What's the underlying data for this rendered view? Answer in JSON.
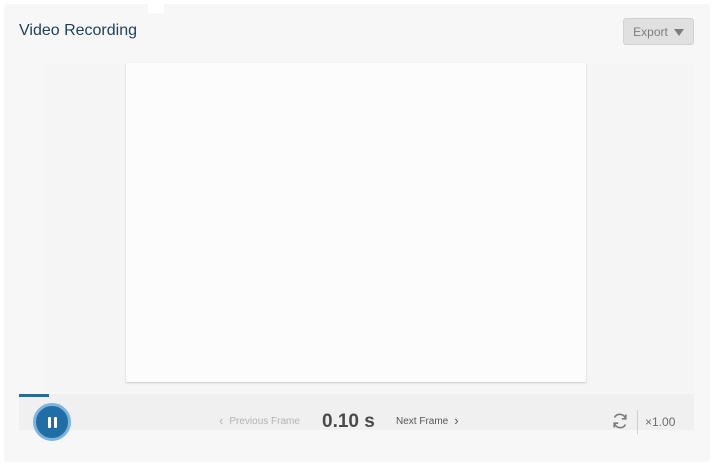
{
  "header": {
    "title": "Video Recording",
    "export_label": "Export"
  },
  "player": {
    "progress_fraction": 0.045,
    "state": "playing"
  },
  "controls": {
    "prev_label": "Previous Frame",
    "prev_enabled": false,
    "time": "0.10 s",
    "next_label": "Next Frame",
    "speed": "×1.00",
    "icons": [
      "pause-icon",
      "chevron-left-icon",
      "chevron-right-icon",
      "loop-icon",
      "caret-down-icon"
    ]
  },
  "colors": {
    "accent": "#1f6ea6",
    "title": "#1d3f5c"
  }
}
